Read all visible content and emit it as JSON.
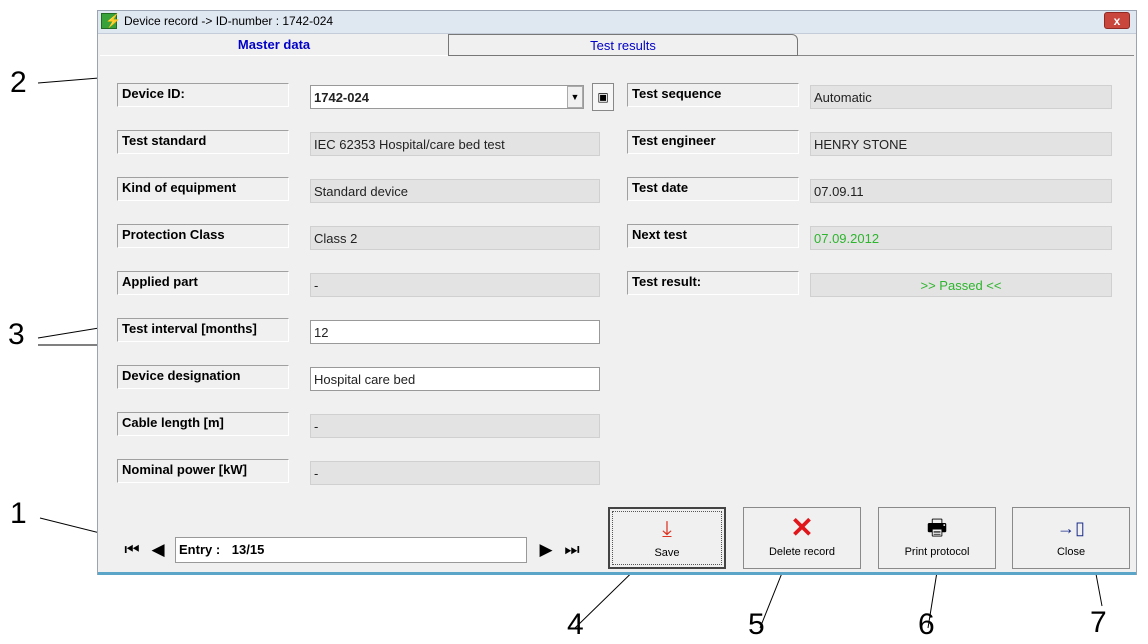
{
  "window": {
    "title": "Device record  -> ID-number : 1742-024",
    "close_glyph": "x",
    "app_icon": "lightning-icon"
  },
  "tabs": [
    {
      "label": "Master data",
      "active": true
    },
    {
      "label": "Test results",
      "active": false
    }
  ],
  "left_fields": [
    {
      "label": "Device ID:",
      "value": "1742-024"
    },
    {
      "label": "Test standard",
      "value": "IEC 62353 Hospital/care bed test"
    },
    {
      "label": "Kind of equipment",
      "value": "Standard device"
    },
    {
      "label": "Protection Class",
      "value": "Class 2"
    },
    {
      "label": "Applied part",
      "value": "-"
    },
    {
      "label": "Test interval [months]",
      "value": "12"
    },
    {
      "label": "Device designation",
      "value": "Hospital care bed"
    },
    {
      "label": "Cable length  [m]",
      "value": "-"
    },
    {
      "label": "Nominal power  [kW]",
      "value": "-"
    }
  ],
  "right_fields": [
    {
      "label": "Test sequence",
      "value": "Automatic"
    },
    {
      "label": "Test engineer",
      "value": "HENRY STONE"
    },
    {
      "label": "Test date",
      "value": "07.09.11"
    },
    {
      "label": "Next test",
      "value": "07.09.2012"
    },
    {
      "label": "Test result:",
      "value": ">> Passed <<"
    }
  ],
  "navigation": {
    "entry_label": "Entry :",
    "entry_value": "13/15"
  },
  "buttons": {
    "save": "Save",
    "delete": "Delete record",
    "print": "Print protocol",
    "close": "Close"
  },
  "callouts": [
    "1",
    "2",
    "3",
    "4",
    "5",
    "6",
    "7"
  ],
  "colors": {
    "accent_text": "#0000c8",
    "pass_green": "#2db52d",
    "delete_red": "#e0161a"
  }
}
